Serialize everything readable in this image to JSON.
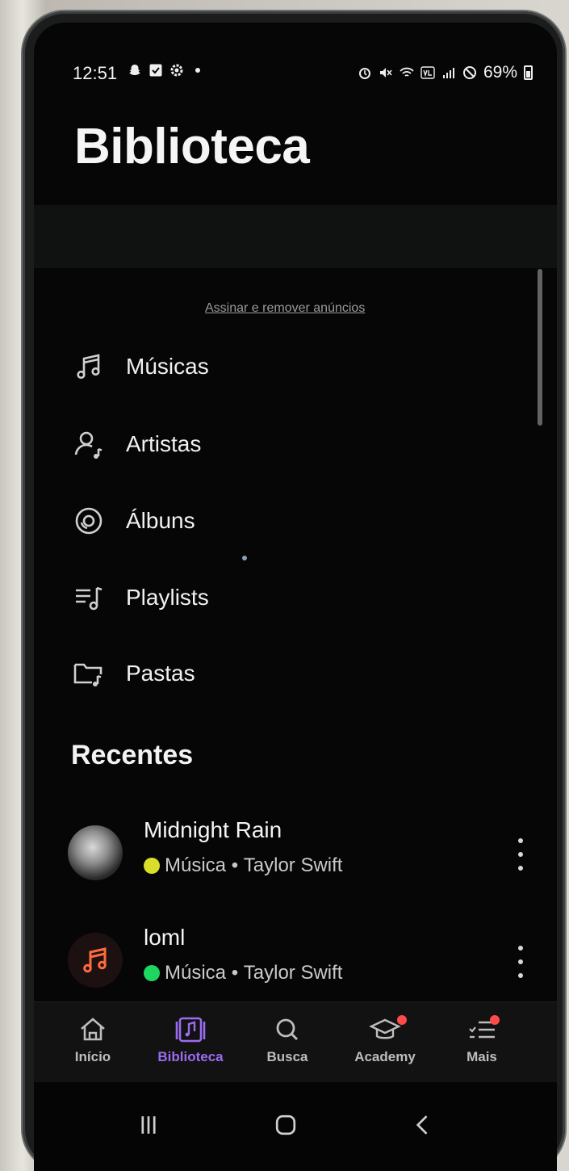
{
  "status_bar": {
    "time": "12:51",
    "battery": "69%",
    "left_icons": [
      "snapchat-icon",
      "checkbox-icon",
      "settings-icon",
      "dot-icon"
    ],
    "right_icons": [
      "alarm-icon",
      "mute-icon",
      "wifi-icon",
      "volte-icon",
      "signal-icon",
      "dnd-icon",
      "battery-icon"
    ]
  },
  "page_title": "Biblioteca",
  "ad": {
    "link_text": "Assinar e remover anúncios"
  },
  "library_items": [
    {
      "label": "Músicas",
      "icon": "music-note-icon"
    },
    {
      "label": "Artistas",
      "icon": "artist-icon"
    },
    {
      "label": "Álbuns",
      "icon": "album-icon"
    },
    {
      "label": "Playlists",
      "icon": "playlist-icon"
    },
    {
      "label": "Pastas",
      "icon": "folder-music-icon"
    }
  ],
  "recent": {
    "title": "Recentes",
    "items": [
      {
        "title": "Midnight Rain",
        "type": "Música",
        "artist": "Taylor Swift",
        "source_color": "#d7df2a",
        "thumb": "photo"
      },
      {
        "title": "loml",
        "type": "Música",
        "artist": "Taylor Swift",
        "source_color": "#1ed760",
        "thumb": "note"
      }
    ]
  },
  "bottom_nav": [
    {
      "label": "Início",
      "icon": "home-icon",
      "active": false
    },
    {
      "label": "Biblioteca",
      "icon": "library-icon",
      "active": true
    },
    {
      "label": "Busca",
      "icon": "search-icon",
      "active": false
    },
    {
      "label": "Academy",
      "icon": "graduation-cap-icon",
      "active": false,
      "badge": true
    },
    {
      "label": "Mais",
      "icon": "menu-list-icon",
      "active": false,
      "badge": true
    }
  ],
  "colors": {
    "accent": "#9c6cf0",
    "note_icon": "#ff6a3d",
    "badge": "#ff4a4a",
    "background": "#060606"
  }
}
